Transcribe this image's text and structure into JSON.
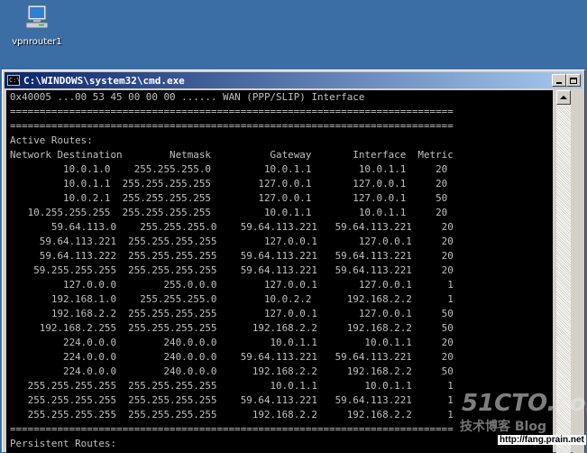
{
  "desktop": {
    "icon_label": "vpnrouter1",
    "icon_name": "computer-icon"
  },
  "window": {
    "title": "C:\\WINDOWS\\system32\\cmd.exe",
    "title_icon": "cmd-icon"
  },
  "console": {
    "interface_line": "0x40005 ...00 53 45 00 00 00 ...... WAN (PPP/SLIP) Interface",
    "separator": "===========================================================================",
    "active_routes_label": "Active Routes:",
    "header": "Network Destination        Netmask          Gateway       Interface  Metric",
    "routes": [
      "         10.0.1.0    255.255.255.0         10.0.1.1        10.0.1.1     20",
      "         10.0.1.1  255.255.255.255        127.0.0.1       127.0.0.1     20",
      "         10.0.2.1  255.255.255.255        127.0.0.1       127.0.0.1     50",
      "   10.255.255.255  255.255.255.255         10.0.1.1        10.0.1.1     20",
      "       59.64.113.0    255.255.255.0    59.64.113.221   59.64.113.221     20",
      "     59.64.113.221  255.255.255.255        127.0.0.1       127.0.0.1     20",
      "     59.64.113.222  255.255.255.255    59.64.113.221   59.64.113.221     20",
      "    59.255.255.255  255.255.255.255    59.64.113.221   59.64.113.221     20",
      "         127.0.0.0        255.0.0.0        127.0.0.1       127.0.0.1      1",
      "       192.168.1.0    255.255.255.0        10.0.2.2      192.168.2.2      1",
      "       192.168.2.2  255.255.255.255        127.0.0.1       127.0.0.1     50",
      "     192.168.2.255  255.255.255.255      192.168.2.2     192.168.2.2     50",
      "         224.0.0.0        240.0.0.0         10.0.1.1        10.0.1.1     20",
      "         224.0.0.0        240.0.0.0    59.64.113.221   59.64.113.221     20",
      "         224.0.0.0        240.0.0.0      192.168.2.2     192.168.2.2     50",
      "   255.255.255.255  255.255.255.255         10.0.1.1        10.0.1.1      1",
      "   255.255.255.255  255.255.255.255    59.64.113.221   59.64.113.221      1",
      "   255.255.255.255  255.255.255.255      192.168.2.2     192.168.2.2      1"
    ],
    "persistent_routes_label": "Persistent Routes:"
  },
  "watermark": {
    "brand": "51CTO.com",
    "blog": "技术博客 Blog",
    "url": "http://fang.prain.net"
  },
  "colors": {
    "desktop_bg": "#3a6ea5",
    "titlebar_start": "#0a246a",
    "titlebar_end": "#a6caf0",
    "console_bg": "#000000",
    "console_fg": "#c0c0c0"
  }
}
